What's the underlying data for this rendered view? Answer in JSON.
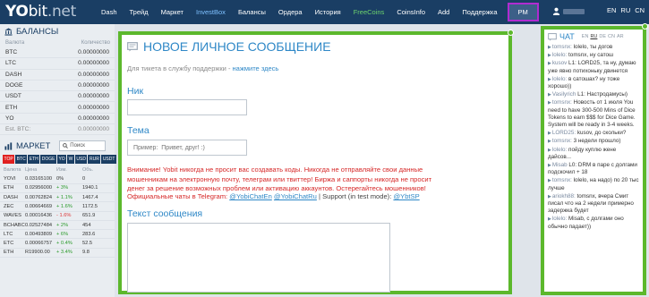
{
  "brand": {
    "yo": "YO",
    "bit": "bit",
    "net": ".net"
  },
  "nav": [
    {
      "label": "Dash",
      "style": "normal"
    },
    {
      "label": "Трейд",
      "style": "normal"
    },
    {
      "label": "Маркет",
      "style": "normal"
    },
    {
      "label": "InvestBox",
      "style": "blue"
    },
    {
      "label": "Балансы",
      "style": "normal"
    },
    {
      "label": "Ордера",
      "style": "normal"
    },
    {
      "label": "История",
      "style": "normal"
    },
    {
      "label": "FreeCoins",
      "style": "green"
    },
    {
      "label": "CoinsInfo",
      "style": "normal"
    },
    {
      "label": "Add",
      "style": "normal"
    },
    {
      "label": "Поддержка",
      "style": "normal"
    },
    {
      "label": "PM",
      "style": "pm"
    }
  ],
  "languages": [
    "EN",
    "RU",
    "CN"
  ],
  "balances": {
    "title": "БАЛАНСЫ",
    "col_currency": "Валюта",
    "col_amount": "Количество",
    "rows": [
      {
        "cur": "BTC",
        "amt": "0.00000000"
      },
      {
        "cur": "LTC",
        "amt": "0.00000000"
      },
      {
        "cur": "DASH",
        "amt": "0.00000000"
      },
      {
        "cur": "DOGE",
        "amt": "0.00000000"
      },
      {
        "cur": "USDT",
        "amt": "0.00000000"
      },
      {
        "cur": "ETH",
        "amt": "0.00000000"
      },
      {
        "cur": "YO",
        "amt": "0.00000000"
      }
    ],
    "est_label": "Est. BTC:",
    "est_value": "0.00000000"
  },
  "market": {
    "title": "МАРКЕТ",
    "search_placeholder": "Поиск",
    "tabs": [
      "TOP",
      "BTC",
      "ETH",
      "DOGE",
      "YO",
      "W",
      "USD",
      "RUR",
      "USDT"
    ],
    "col_currency": "Валюта",
    "col_price": "Цена",
    "col_change": "Изм.",
    "col_volume": "Объ.",
    "rows": [
      {
        "cur": "YOVI",
        "price": "0.03165100",
        "change": "0%",
        "vol": "0",
        "dir": "neutral"
      },
      {
        "cur": "ETH",
        "price": "0.02956000",
        "change": "+ 3%",
        "vol": "1940.1",
        "dir": "up"
      },
      {
        "cur": "DASH",
        "price": "0.00762824",
        "change": "+ 1.1%",
        "vol": "1467.4",
        "dir": "up"
      },
      {
        "cur": "ZEC",
        "price": "0.00664669",
        "change": "+ 1.6%",
        "vol": "1172.5",
        "dir": "up"
      },
      {
        "cur": "WAVES",
        "price": "0.00016436",
        "change": "- 1.6%",
        "vol": "651.9",
        "dir": "down"
      },
      {
        "cur": "BCHABC",
        "price": "0.02527484",
        "change": "+ 2%",
        "vol": "454",
        "dir": "up"
      },
      {
        "cur": "LTC",
        "price": "0.00493809",
        "change": "+ 6%",
        "vol": "283.6",
        "dir": "up"
      },
      {
        "cur": "ETC",
        "price": "0.00066757",
        "change": "+ 0.4%",
        "vol": "52.5",
        "dir": "up"
      },
      {
        "cur": "ETH",
        "price": "R19900.00",
        "change": "+ 3.4%",
        "vol": "9.8",
        "dir": "up"
      }
    ]
  },
  "pm": {
    "title": "НОВОЕ ЛИЧНОЕ СООБЩЕНИЕ",
    "hint_text": "Для тикета в службу поддержки - ",
    "hint_link": "нажмите здесь",
    "nick_label": "Ник",
    "subject_label": "Тема",
    "subject_value": "Пример:  Привет, друг! :)",
    "warning": "Внимание! Yobit никогда не просит вас создавать коды. Никогда не отправляйте свои данные мошенникам на электронную почту, телеграм или твиттер! Биржа и саппорты никогда не просит денег за решение возможных проблем или активацию аккаунтов. Остерегайтесь мошенников!",
    "official_chats_label": "Официальные чаты в Telegram: ",
    "official_chat_en": "@YobiChatEn",
    "official_chat_ru": "@YobiChatRu",
    "support_label": " | Support (in test mode): ",
    "support_handle": "@YbtSP",
    "message_label": "Текст сообщения"
  },
  "chat": {
    "title": "ЧАТ",
    "langs": [
      "EN",
      "RU",
      "DE",
      "CN",
      "AR"
    ],
    "active_lang": "RU",
    "messages": [
      {
        "nick": "tomsnx:",
        "text": " lolelo, ты догов"
      },
      {
        "nick": "lolelo:",
        "text": " tomsnx, ну сатош"
      },
      {
        "nick": "kusov",
        "text": " L1: LORD25, та ну, думаю уже явно потихоньку двинется"
      },
      {
        "nick": "lolelo:",
        "text": " в сатошах? ну тоже хорошо))"
      },
      {
        "nick": "Vasilyrich",
        "text": " L1: Настродамусы)"
      },
      {
        "nick": "tomsnx:",
        "text": " Новость от 1 июля You need to have 300-500 Mins of Dice Tokens to earn $$$ for Dice Game. System will be ready in 3-4 weeks."
      },
      {
        "nick": "LORD25:",
        "text": " kusov, до скольки?"
      },
      {
        "nick": "tomsnx:",
        "text": " 3 недели прошло)"
      },
      {
        "nick": "lolelo:",
        "text": " пойду куплю жене дайсов..."
      },
      {
        "nick": "Misab",
        "text": " L0: DRM в паре с долгами подскочил + 18"
      },
      {
        "nick": "tomsnx:",
        "text": " lolelo, на надо) по 20 тыс лучше"
      },
      {
        "nick": "ariokh88:",
        "text": " tomsnx, вчера Смит писал что на 2 недели примерно задержка будет"
      },
      {
        "nick": "lolelo:",
        "text": " Misab, с долгами оно обычно падает))"
      }
    ]
  }
}
